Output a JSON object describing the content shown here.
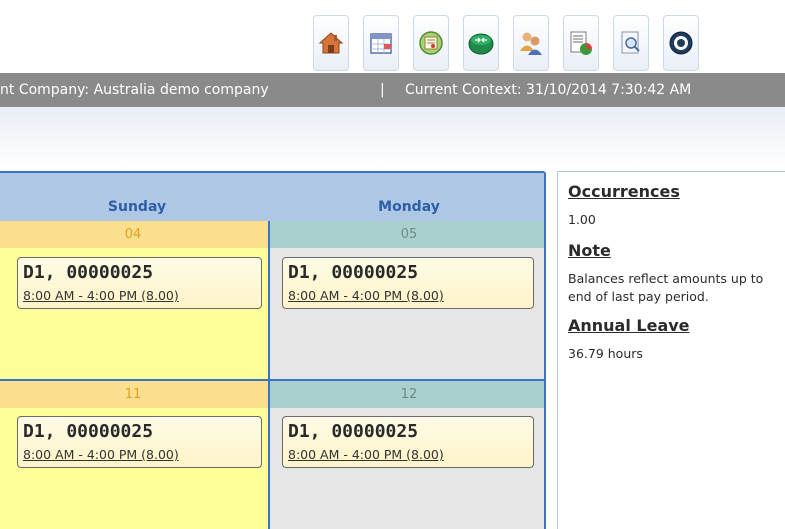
{
  "toolbar": {
    "icons": [
      "home-icon",
      "calendar-icon",
      "certificate-icon",
      "network-icon",
      "users-icon",
      "report-chart-icon",
      "search-document-icon",
      "help-icon"
    ]
  },
  "context_bar": {
    "company_text": "nt Company: Australia demo company",
    "separator": "|",
    "context_text": "Current Context: 31/10/2014 7:30:42 AM"
  },
  "calendar": {
    "days": [
      "Sunday",
      "Monday"
    ],
    "weeks": [
      {
        "cells": [
          {
            "day_number": "04",
            "shift_title": "D1, 00000025",
            "shift_time": "8:00 AM - 4:00 PM (8.00)"
          },
          {
            "day_number": "05",
            "shift_title": "D1, 00000025",
            "shift_time": "8:00 AM - 4:00 PM (8.00)"
          }
        ]
      },
      {
        "cells": [
          {
            "day_number": "11",
            "shift_title": "D1, 00000025",
            "shift_time": "8:00 AM - 4:00 PM (8.00)"
          },
          {
            "day_number": "12",
            "shift_title": "D1, 00000025",
            "shift_time": "8:00 AM - 4:00 PM (8.00)"
          }
        ]
      }
    ]
  },
  "side_panel": {
    "occurrences_heading": "Occurrences",
    "occurrences_value": "1.00",
    "note_heading": "Note",
    "note_text": "Balances reflect amounts up to end of last pay period.",
    "annual_leave_heading": "Annual Leave",
    "annual_leave_value": "36.79 hours"
  },
  "colors": {
    "context_bar": "#8a8a8a",
    "calendar_border": "#3b73c7",
    "calendar_header": "#aec7e5",
    "sunday_cell": "#ffff99",
    "monday_cell": "#e6e6e6"
  }
}
